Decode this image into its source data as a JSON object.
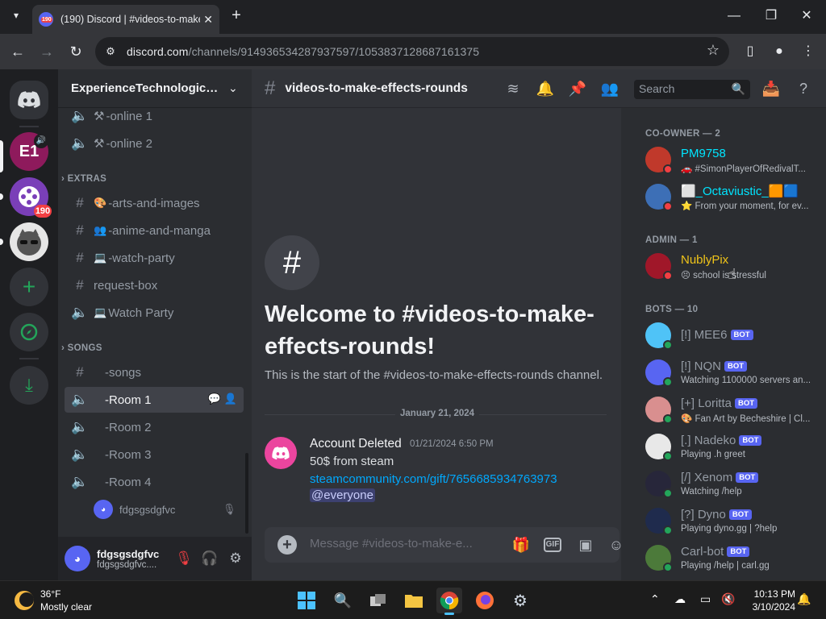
{
  "browser": {
    "tab_title": "(190) Discord | #videos-to-make",
    "url_host": "discord.com",
    "url_path": "/channels/914936534287937597/1053837128687161375"
  },
  "server_rail": {
    "unread_badge": "190",
    "server_icon_text": "E1"
  },
  "guild": {
    "name": "ExperienceTechnologica..."
  },
  "channels": {
    "top": [
      {
        "name": "-online 1",
        "icon": "speaker-icon"
      },
      {
        "name": "-online 2",
        "icon": "speaker-icon"
      }
    ],
    "extras_label": "EXTRAS",
    "extras": [
      {
        "name": "-arts-and-images",
        "icon": "hash-icon",
        "emoji": "🎨"
      },
      {
        "name": "-anime-and-manga",
        "icon": "hash-icon",
        "emoji": "👥"
      },
      {
        "name": "-watch-party",
        "icon": "hash-icon",
        "emoji": "💻"
      },
      {
        "name": "request-box",
        "icon": "hash-icon",
        "emoji": ""
      },
      {
        "name": "Watch Party",
        "icon": "speaker-icon",
        "emoji": "💻"
      }
    ],
    "songs_label": "SONGS",
    "songs": [
      {
        "name": "-songs",
        "icon": "hash-icon"
      },
      {
        "name": "-Room 1",
        "icon": "speaker-icon"
      },
      {
        "name": "-Room 2",
        "icon": "speaker-icon"
      },
      {
        "name": "-Room 3",
        "icon": "speaker-icon"
      },
      {
        "name": "-Room 4",
        "icon": "speaker-icon"
      }
    ],
    "voice_user": "fdgsgsdgfvc"
  },
  "user_panel": {
    "name": "fdgsgsdgfvc",
    "sub": "fdgsgsdgfvc...."
  },
  "chat_header": {
    "channel": "videos-to-make-effects-rounds",
    "search_placeholder": "Search"
  },
  "welcome": {
    "title": "Welcome to #videos-to-make-effects-rounds!",
    "subtitle": "This is the start of the #videos-to-make-effects-rounds channel."
  },
  "divider_date": "January 21, 2024",
  "message": {
    "author": "Account Deleted",
    "timestamp": "01/21/2024 6:50 PM",
    "line1": "50$ from steam",
    "link": "steamcommunity.com/gift/7656685934763973",
    "mention": "@everyone"
  },
  "composer": {
    "placeholder": "Message #videos-to-make-e..."
  },
  "members": {
    "co_owner_label": "CO-OWNER — 2",
    "admin_label": "ADMIN — 1",
    "bots_label": "BOTS — 10",
    "bot_tag": "BOT",
    "co_owners": [
      {
        "name": "PM9758",
        "activity": "🚗 #SimonPlayerOfRedivalT...",
        "color": "#00e5ff",
        "avatar": "#c0392b",
        "status": "#f23f43"
      },
      {
        "name": "⬜_Octaviustic_🟧🟦",
        "activity": "⭐ From your moment, for ev...",
        "color": "#00e5ff",
        "avatar": "#3d6fb6",
        "status": "#f23f43"
      }
    ],
    "admins": [
      {
        "name": "NublyPix",
        "activity": "😣 school is stressful",
        "color": "#f0c419",
        "avatar": "#a01729",
        "status": "#f23f43"
      }
    ],
    "bots": [
      {
        "name": "[!] MEE6",
        "activity": "",
        "avatar": "#4fc3f7",
        "status": "#23a55a"
      },
      {
        "name": "[!] NQN",
        "activity": "Watching 1100000 servers an...",
        "avatar": "#5865f2",
        "status": "#23a55a"
      },
      {
        "name": "[+] Loritta",
        "activity": "🎨 Fan Art by Becheshire | Cl...",
        "avatar": "#d98f8f",
        "status": "#23a55a"
      },
      {
        "name": "[.] Nadeko",
        "activity": "Playing .h greet",
        "avatar": "#e8e8e8",
        "status": "#23a55a"
      },
      {
        "name": "[/] Xenom",
        "activity": "Watching /help",
        "avatar": "#27263a",
        "status": "#23a55a"
      },
      {
        "name": "[?] Dyno",
        "activity": "Playing dyno.gg | ?help",
        "avatar": "#1f2b4d",
        "status": "#23a55a"
      },
      {
        "name": "Carl-bot",
        "activity": "Playing /help | carl.gg",
        "avatar": "#4c7a3a",
        "status": "#23a55a"
      }
    ]
  },
  "taskbar": {
    "temp": "36°F",
    "weather": "Mostly clear",
    "time": "10:13 PM",
    "date": "3/10/2024"
  }
}
